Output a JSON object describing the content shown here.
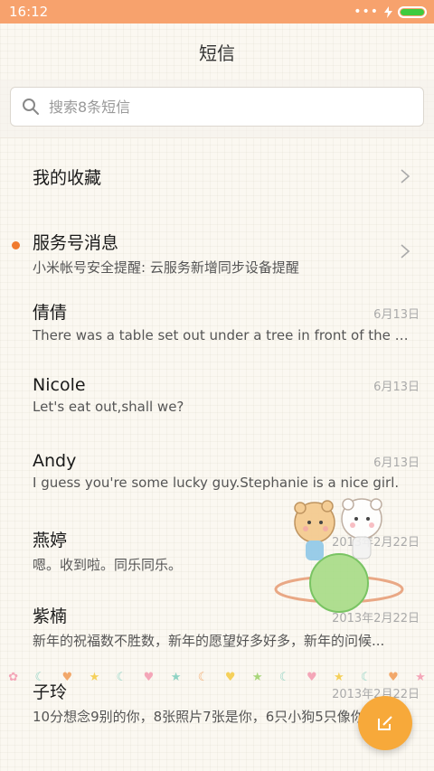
{
  "status": {
    "time": "16:12"
  },
  "header": {
    "title": "短信"
  },
  "search": {
    "placeholder": "搜索8条短信"
  },
  "favorites": {
    "label": "我的收藏"
  },
  "service": {
    "title": "服务号消息",
    "preview": "小米帐号安全提醒: 云服务新增同步设备提醒"
  },
  "messages": [
    {
      "name": "倩倩",
      "date": "6月13日",
      "preview": "There was a table set out under a tree in front of the ho..."
    },
    {
      "name": "Nicole",
      "date": "6月13日",
      "preview": "Let's eat out,shall we?"
    },
    {
      "name": "Andy",
      "date": "6月13日",
      "preview": "I guess you're some lucky guy.Stephanie is a nice girl."
    },
    {
      "name": "燕婷",
      "date": "2013年2月22日",
      "preview": "嗯。收到啦。同乐同乐。"
    },
    {
      "name": "紫楠",
      "date": "2013年2月22日",
      "preview": "新年的祝福数不胜数，新年的愿望好多好多，新年的问候..."
    },
    {
      "name": "子玲",
      "date": "2013年2月22日",
      "preview": "10分想念9别的你，8张照片7张是你，6只小狗5只像你..."
    }
  ],
  "icons": {
    "search": "search-icon",
    "chevron": "chevron-right-icon",
    "compose": "compose-icon",
    "battery": "battery-icon",
    "flash": "charging-icon"
  },
  "colors": {
    "statusbar": "#f7a26d",
    "accent": "#f7a93a",
    "unread": "#f07a2e",
    "battery": "#3ecb3e"
  }
}
